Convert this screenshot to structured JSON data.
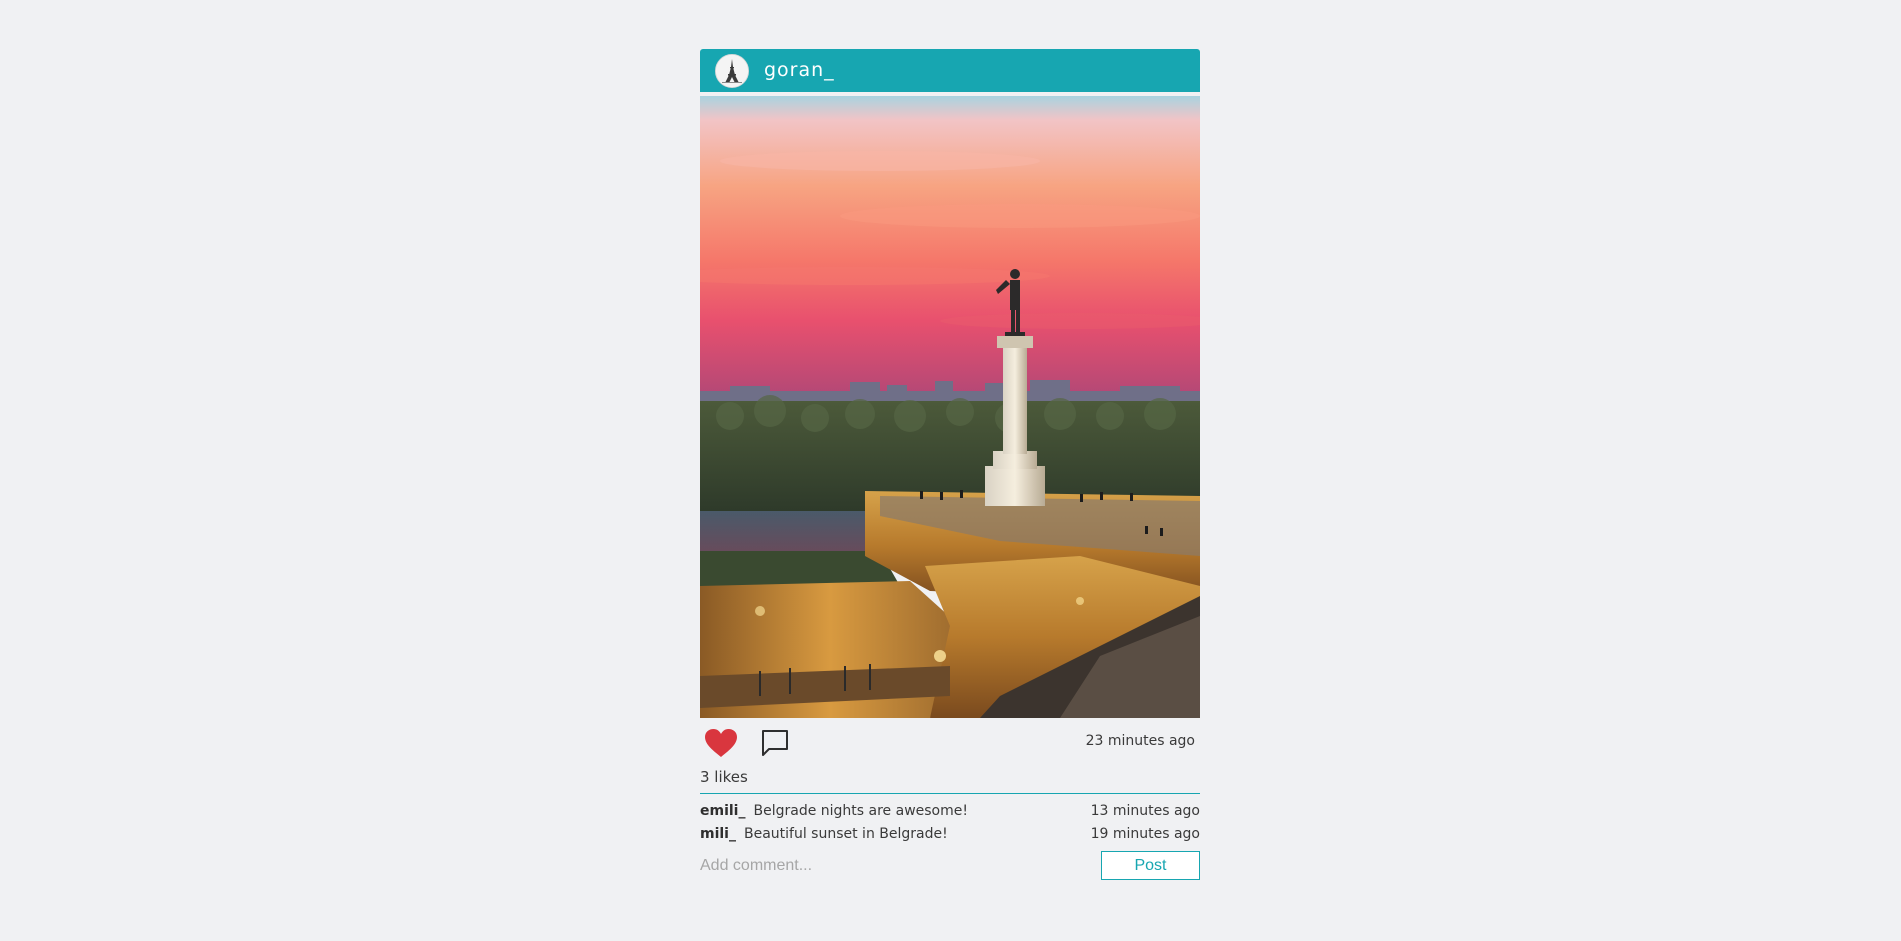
{
  "post": {
    "username": "goran_",
    "time": "23 minutes ago",
    "likes_text": "3 likes",
    "photo_icon": "sunset-monument-photo",
    "like_icon": "heart-icon",
    "comment_icon": "speech-bubble-icon",
    "avatar_icon": "eiffel-tower-avatar"
  },
  "comments": [
    {
      "author": "emili_",
      "text": "Belgrade nights are awesome!",
      "time": "13 minutes ago"
    },
    {
      "author": "mili_",
      "text": "Beautiful sunset in Belgrade!",
      "time": "19 minutes ago"
    }
  ],
  "add_comment": {
    "placeholder": "Add comment...",
    "button_label": "Post"
  },
  "colors": {
    "accent": "#17a6b1",
    "background": "#f0f1f3",
    "heart": "#d9363e"
  }
}
